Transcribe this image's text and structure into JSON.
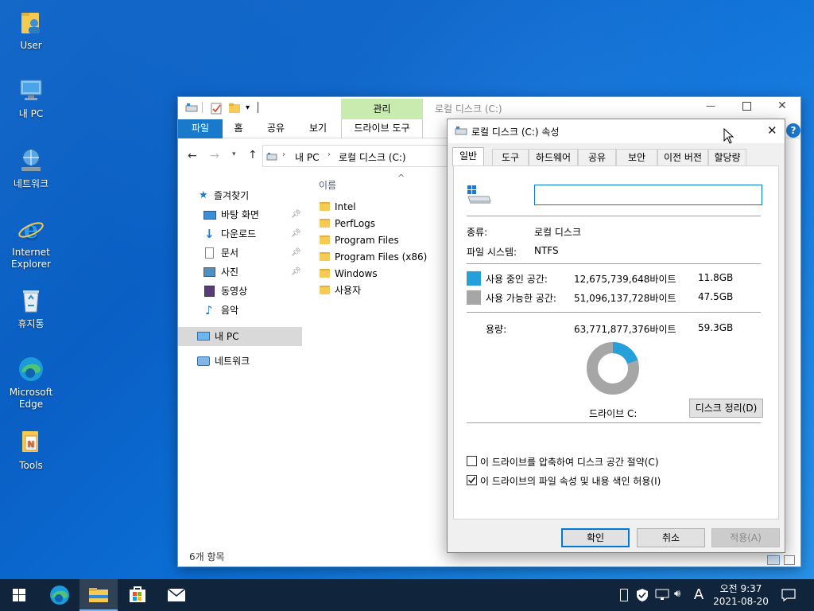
{
  "desktop": {
    "icons": [
      {
        "label": "User",
        "icon": "user-folder-icon"
      },
      {
        "label": "내 PC",
        "icon": "computer-icon"
      },
      {
        "label": "네트워크",
        "icon": "network-icon"
      },
      {
        "label": "Internet Explorer",
        "icon": "internet-explorer-icon"
      },
      {
        "label": "휴지통",
        "icon": "recycle-bin-icon"
      },
      {
        "label": "Microsoft Edge",
        "icon": "edge-icon"
      },
      {
        "label": "Tools",
        "icon": "tools-icon"
      }
    ]
  },
  "explorer": {
    "title": "로컬 디스크 (C:)",
    "manage_tab": "관리",
    "ribbon_tabs": [
      "파일",
      "홈",
      "공유",
      "보기",
      "드라이브 도구"
    ],
    "address": {
      "segments": [
        "내 PC",
        "로컬 디스크 (C:)"
      ]
    },
    "nav": {
      "quick_access": "즐겨찾기",
      "items": [
        {
          "label": "바탕 화면",
          "pinned": true
        },
        {
          "label": "다운로드",
          "pinned": true
        },
        {
          "label": "문서",
          "pinned": true
        },
        {
          "label": "사진",
          "pinned": true
        },
        {
          "label": "동영상",
          "pinned": false
        },
        {
          "label": "음악",
          "pinned": false
        }
      ],
      "this_pc": "내 PC",
      "network": "네트워크"
    },
    "column_header": "이름",
    "files": [
      "Intel",
      "PerfLogs",
      "Program Files",
      "Program Files (x86)",
      "Windows",
      "사용자"
    ],
    "status": "6개 항목"
  },
  "dialog": {
    "title": "로컬 디스크 (C:) 속성",
    "tabs": [
      "일반",
      "도구",
      "하드웨어",
      "공유",
      "보안",
      "이전 버전",
      "할당량"
    ],
    "name_value": "",
    "type_label": "종류:",
    "type_value": "로컬 디스크",
    "fs_label": "파일 시스템:",
    "fs_value": "NTFS",
    "used": {
      "label": "사용 중인 공간:",
      "bytes": "12,675,739,648바이트",
      "size": "11.8GB",
      "color": "#26a0da"
    },
    "free": {
      "label": "사용 가능한 공간:",
      "bytes": "51,096,137,728바이트",
      "size": "47.5GB",
      "color": "#a6a6a6"
    },
    "capacity": {
      "label": "용량:",
      "bytes": "63,771,877,376바이트",
      "size": "59.3GB"
    },
    "used_fraction": 0.199,
    "drive_label": "드라이브 C:",
    "cleanup_button": "디스크 정리(D)",
    "compress_checkbox": {
      "label": "이 드라이브를 압축하여 디스크 공간 절약(C)",
      "checked": false
    },
    "index_checkbox": {
      "label": "이 드라이브의 파일 속성 및 내용 색인 허용(I)",
      "checked": true
    },
    "buttons": {
      "ok": "확인",
      "cancel": "취소",
      "apply": "적용(A)"
    }
  },
  "taskbar": {
    "ime": "A",
    "time": "오전 9:37",
    "date": "2021-08-20"
  }
}
